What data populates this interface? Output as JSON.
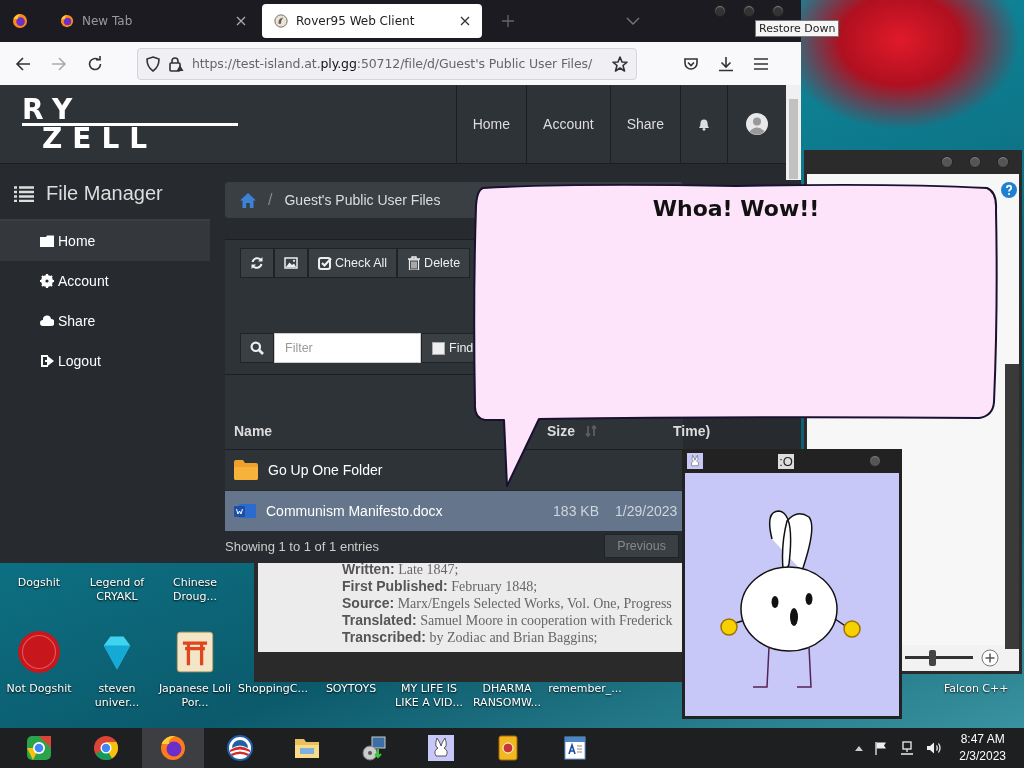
{
  "desktop": {
    "icons_row1": [
      {
        "label": "Dogshit"
      },
      {
        "label": "Legend of CRYAKL"
      },
      {
        "label": "Chinese Droug..."
      }
    ],
    "icons_row2": [
      {
        "label": "Not Dogshit",
        "kind": "devcpp"
      },
      {
        "label": "steven univer...",
        "kind": "gem"
      },
      {
        "label": "Japanese Loli Por...",
        "kind": "gate"
      },
      {
        "label": "ShoppingC..."
      },
      {
        "label": "SOYTOYS"
      },
      {
        "label": "MY LIFE IS LIKE A VID..."
      },
      {
        "label": "DHARMA RANSOMW..."
      },
      {
        "label": "remember_..."
      }
    ],
    "side_icon": {
      "label": "Falcon C++"
    }
  },
  "browser": {
    "tabs": [
      {
        "label": "New Tab",
        "selected": false
      },
      {
        "label": "Rover95 Web Client",
        "selected": true
      }
    ],
    "tooltip": "Restore Down",
    "url": "https://test-island.at.**ply.gg**:50712/file/d/Guest's Public User Files/"
  },
  "site": {
    "logo": [
      "RY",
      "ZELL"
    ],
    "nav": [
      {
        "label": "Home"
      },
      {
        "label": "Account"
      },
      {
        "label": "Share"
      }
    ],
    "sidebar": {
      "title": "File Manager",
      "items": [
        {
          "label": "Home",
          "selected": true
        },
        {
          "label": "Account",
          "selected": false
        },
        {
          "label": "Share",
          "selected": false
        },
        {
          "label": "Logout",
          "selected": false
        }
      ]
    },
    "breadcrumb": {
      "separator": "/",
      "current": "Guest's Public User Files"
    },
    "toolbar": [
      {
        "kind": "refresh"
      },
      {
        "kind": "image"
      },
      {
        "kind": "checkall",
        "label": "Check All"
      },
      {
        "kind": "delete",
        "label": "Delete"
      }
    ],
    "filter": {
      "placeholder": "Filter"
    },
    "find": {
      "label": "Find",
      "checked": false
    },
    "table": {
      "columns": [
        "Name",
        "Size",
        "Time)"
      ],
      "rows": [
        {
          "kind": "folder",
          "name": "Go Up One Folder",
          "selected": false
        },
        {
          "kind": "doc",
          "name": "Communism Manifesto.docx",
          "size": "183 KB",
          "time": "1/29/2023",
          "selected": true
        }
      ]
    },
    "footer": "Showing 1 to 1 of 1 entries",
    "previous": "Previous"
  },
  "document_window": {
    "lines": [
      "**Written:** Late 1847;",
      "**First Published:** February 1848;",
      "**Source:** Marx/Engels Selected Works, Vol. One, Progress",
      "**Translated:** Samuel Moore in cooperation with Frederick",
      "**Transcribed:** by Zodiac and Brian Baggins;"
    ]
  },
  "right_window": {
    "zoom": {
      "level": 0.4
    }
  },
  "speech_bubble": {
    "text": "Whoa! Wow!!"
  },
  "bunny_window": {
    "title": ":O"
  },
  "taskbar": {
    "apps": [
      {
        "kind": "chromeold",
        "active": false
      },
      {
        "kind": "chrome",
        "active": false
      },
      {
        "kind": "firefox",
        "active": true
      },
      {
        "kind": "obama",
        "active": false
      },
      {
        "kind": "explorer",
        "active": false
      },
      {
        "kind": "installer",
        "active": false
      },
      {
        "kind": "bunny",
        "active": false
      },
      {
        "kind": "mahjong",
        "active": false
      },
      {
        "kind": "wordpad",
        "active": false
      }
    ],
    "clock": {
      "time": "8:47 AM",
      "date": "2/3/2023"
    }
  }
}
